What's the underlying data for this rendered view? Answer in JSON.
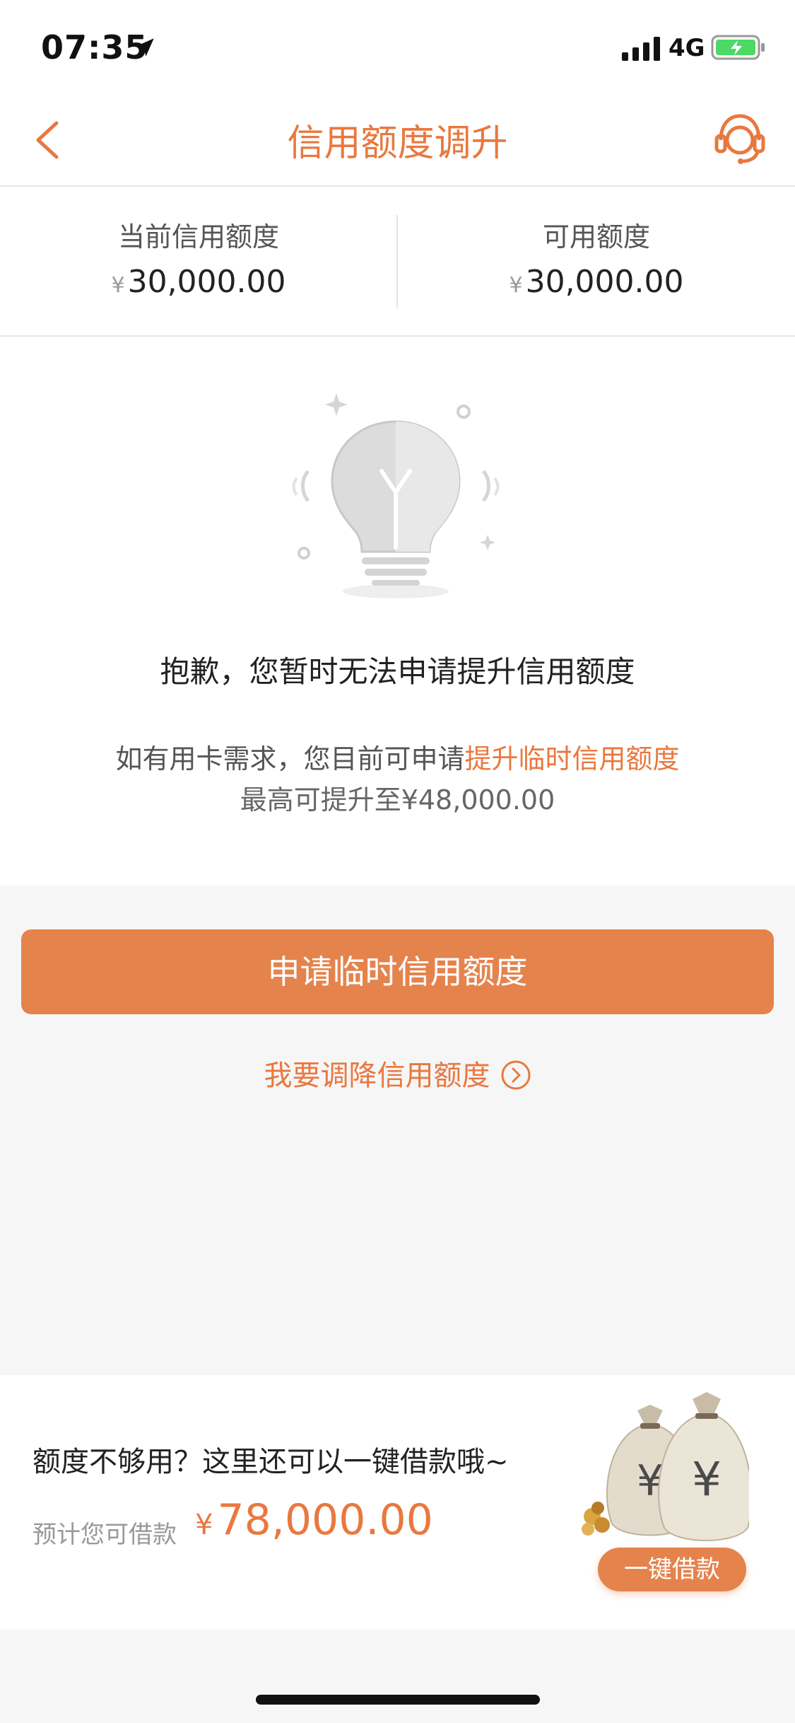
{
  "status_bar": {
    "time": "07:35",
    "network": "4G"
  },
  "nav": {
    "title": "信用额度调升"
  },
  "summary": {
    "current": {
      "label": "当前信用额度",
      "currency": "¥",
      "value": "30,000.00"
    },
    "available": {
      "label": "可用额度",
      "currency": "¥",
      "value": "30,000.00"
    }
  },
  "notice": {
    "title": "抱歉，您暂时无法申请提升信用额度",
    "line1_prefix": "如有用卡需求，您目前可申请",
    "line1_link": "提升临时信用额度",
    "line2": "最高可提升至¥48,000.00"
  },
  "actions": {
    "primary_label": "申请临时信用额度",
    "decrease_label": "我要调降信用额度"
  },
  "loan": {
    "title": "额度不够用？这里还可以一键借款哦~",
    "label": "预计您可借款",
    "currency": "¥",
    "amount": "78,000.00",
    "button_label": "一键借款"
  },
  "colors": {
    "accent": "#e9783f",
    "button": "#e5834d"
  },
  "icons": {
    "location": "location-arrow-icon",
    "signal": "signal-icon",
    "battery": "battery-charging-icon",
    "back": "chevron-left-icon",
    "service": "headset-icon",
    "bulb": "lightbulb-illustration",
    "arrow": "circle-arrow-right-icon",
    "bags": "money-bag-illustration"
  }
}
